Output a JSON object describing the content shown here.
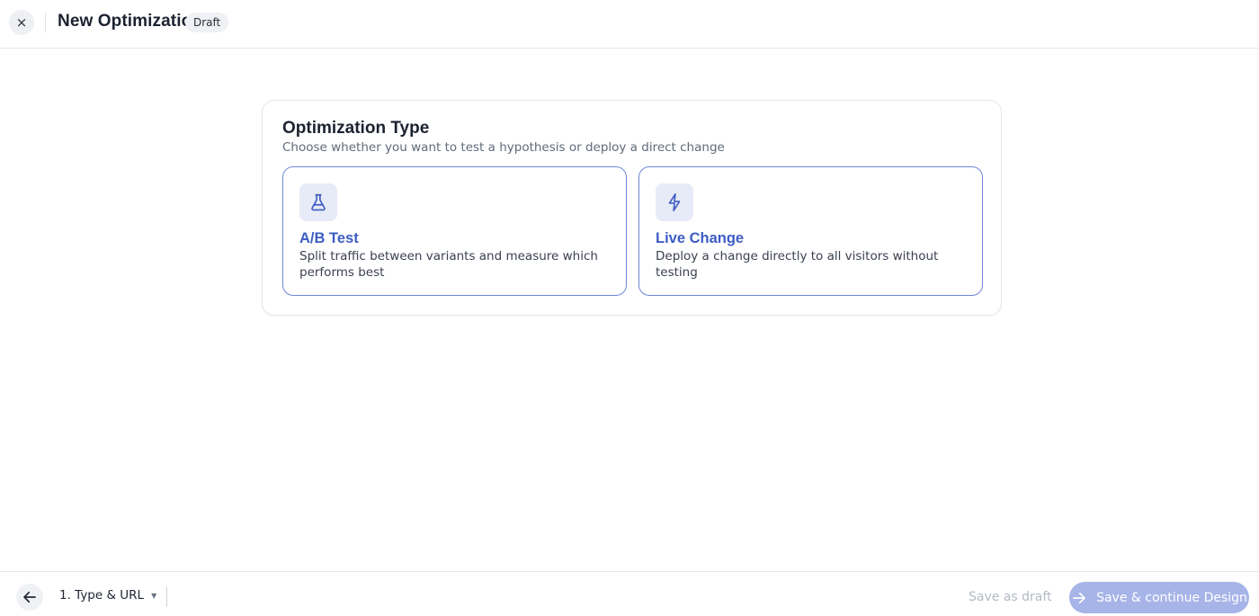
{
  "header": {
    "close_glyph": "×",
    "title": "New Optimization",
    "status_badge": "Draft"
  },
  "card": {
    "title": "Optimization Type",
    "subtitle": "Choose whether you want to test a hypothesis or deploy a direct change",
    "options": [
      {
        "icon": "flask-icon",
        "title": "A/B Test",
        "description": "Split traffic between variants and measure which performs best"
      },
      {
        "icon": "lightning-bolt-icon",
        "title": "Live Change",
        "description": "Deploy a change directly to all visitors without testing"
      }
    ]
  },
  "footer": {
    "step_label": "1. Type & URL",
    "save_draft_label": "Save as draft",
    "continue_label": "Save & continue Design"
  },
  "colors": {
    "accent": "#3d5cc4",
    "option_border": "#6f86d6",
    "icon_bg": "#e7ebf7",
    "primary_button_disabled": "#a7b4e8"
  }
}
